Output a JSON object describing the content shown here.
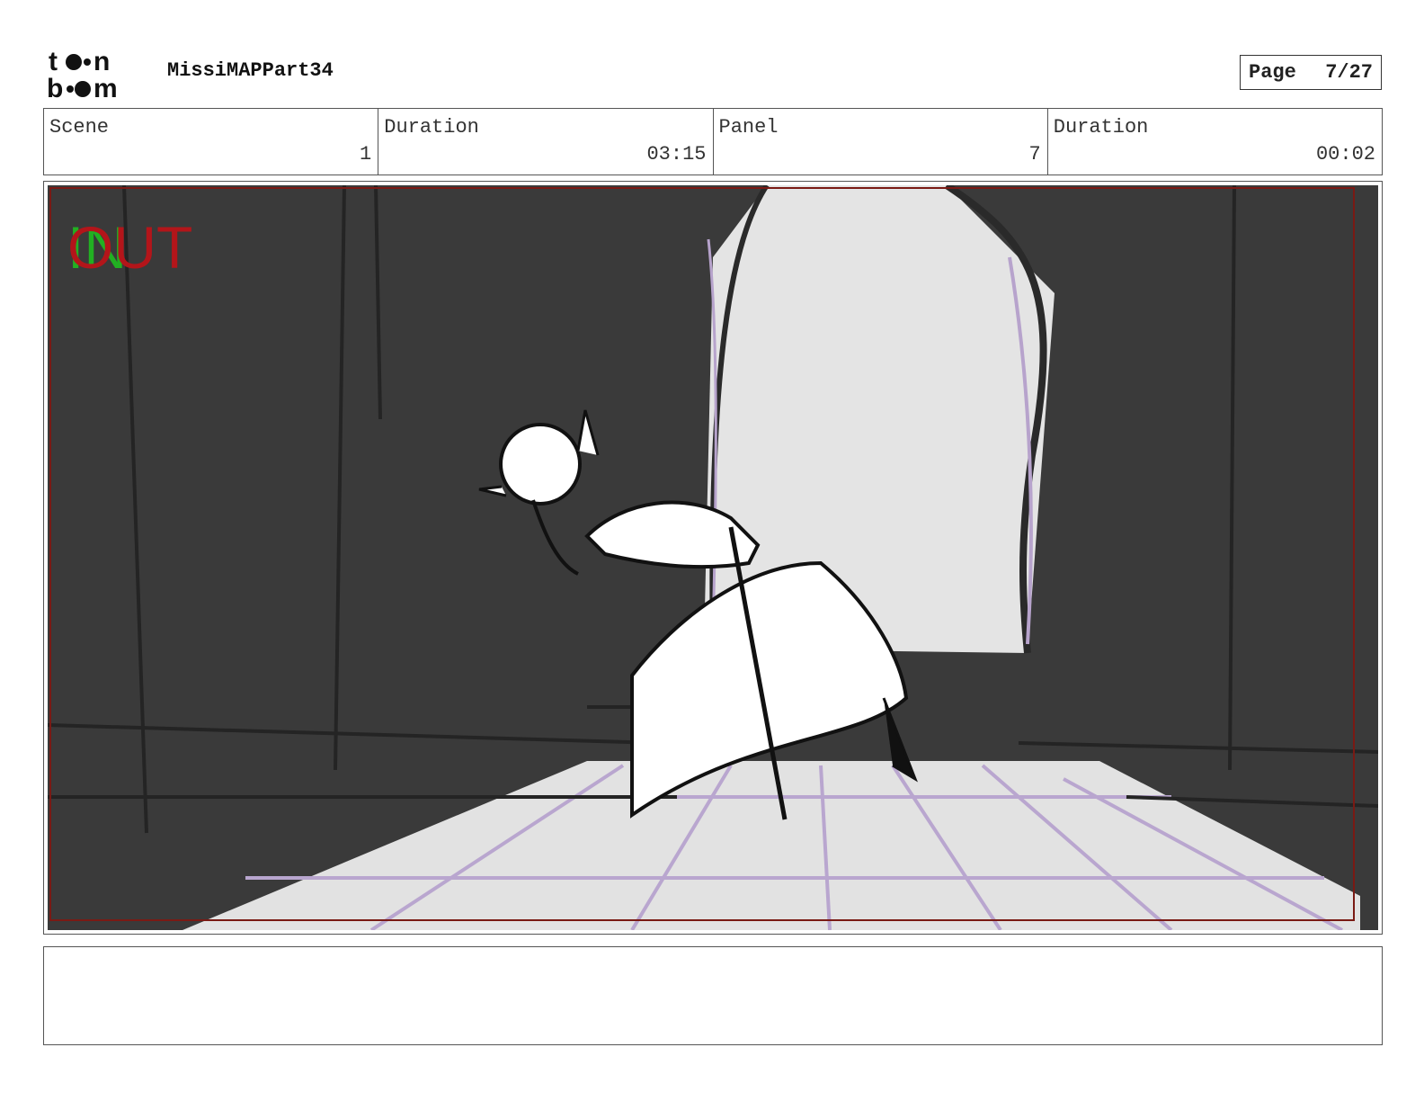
{
  "header": {
    "logo_text_top": "toon",
    "logo_text_bottom": "boom",
    "project_title": "MissiMAPPart34",
    "page_label": "Page",
    "page_value": "7/27"
  },
  "info": {
    "scene_label": "Scene",
    "scene_value": "1",
    "scene_duration_label": "Duration",
    "scene_duration_value": "03:15",
    "panel_label": "Panel",
    "panel_value": "7",
    "panel_duration_label": "Duration",
    "panel_duration_value": "00:02"
  },
  "panel": {
    "in_marker": "IN",
    "out_marker": "OUT",
    "colors": {
      "background_dark": "#3a3a3a",
      "doorway_light": "#e4e4e4",
      "floor_light": "#e2e2e2",
      "floor_grid": "#b9a6cf",
      "in_color": "#22b022",
      "out_color": "#b3151a",
      "frame_border": "#7a1a14"
    }
  },
  "notes": {
    "text": ""
  }
}
